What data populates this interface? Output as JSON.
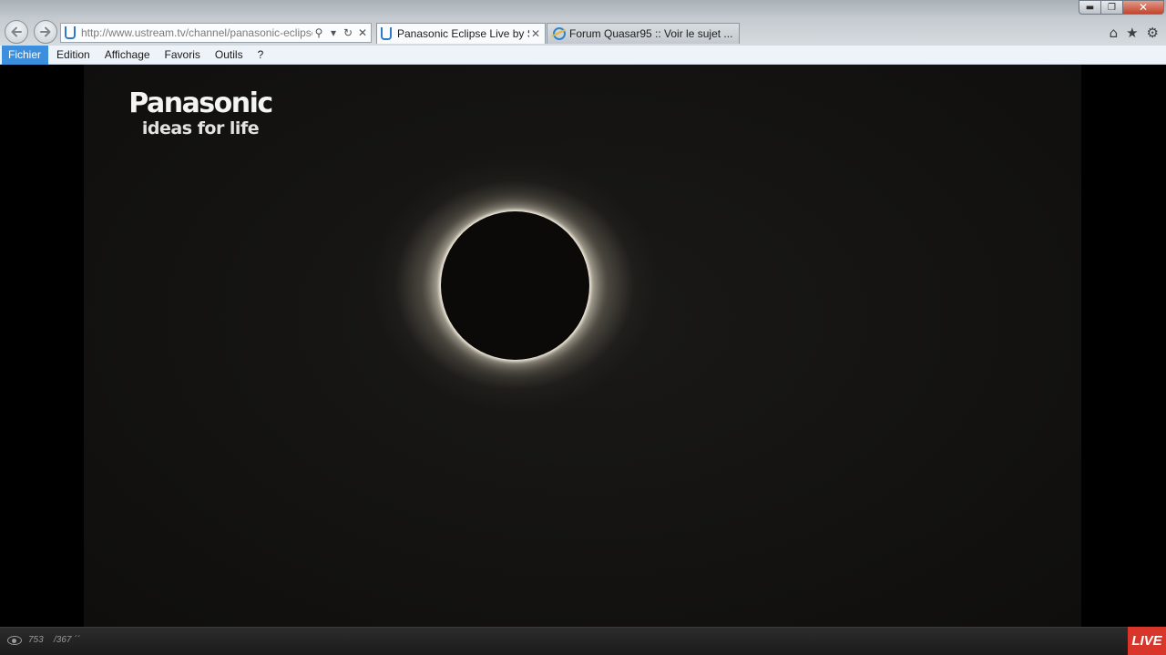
{
  "browser": {
    "address_bar": {
      "url": "http://www.ustream.tv/channel/panasonic-eclipse"
    },
    "tabs": [
      {
        "label": "Panasonic Eclipse Live by S...",
        "active": true,
        "icon": "ustream-u-icon"
      },
      {
        "label": "Forum Quasar95 :: Voir le sujet ...",
        "active": false,
        "icon": "internet-explorer-icon"
      }
    ],
    "toolbar_icons": [
      "home-icon",
      "star-icon",
      "gear-icon"
    ]
  },
  "menu": {
    "items": [
      "Fichier",
      "Edition",
      "Affichage",
      "Favoris",
      "Outils",
      "?"
    ],
    "selected": "Fichier"
  },
  "video": {
    "brand_name": "Panasonic",
    "brand_tagline": "ideas for life"
  },
  "player": {
    "viewer_count": "753",
    "total_count": "/367 ´´",
    "live_label": "LIVE"
  },
  "colors": {
    "menu_highlight": "#3c8fdc",
    "live_badge": "#d8362a",
    "video_background": "#141311"
  }
}
